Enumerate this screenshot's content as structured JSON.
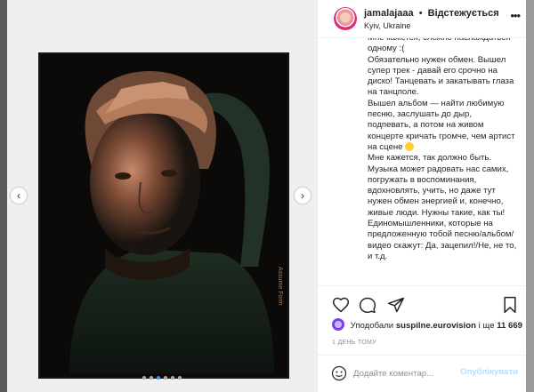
{
  "colors": {
    "accent": "#3897f0",
    "text": "#262626",
    "muted": "#8e8e8e",
    "publish_disabled": "#b2dffc"
  },
  "post": {
    "username": "jamalajaaa",
    "separator": "•",
    "follow_state": "Відстежується",
    "location": "Kyiv, Ukraine",
    "more_icon": "more-horizontal-icon",
    "photo": {
      "credit": "Assume Form"
    },
    "carousel": {
      "prev_icon": "chevron-left-icon",
      "next_icon": "chevron-right-icon",
      "dot_count": 6,
      "active_index": 2
    },
    "caption": [
      "Мне кажется, сложно наслаждаться одному :(",
      "Обязательно нужен обмен. Вышел супер трек - давай его срочно на диско! Танцевать и закатывать глаза на танцполе.",
      "Вышел альбом — найти любимую песню, заслушать до дыр, подпевать, а потом на живом концерте кричать громче, чем артист на сцене",
      "Мне кажется, так должно быть. Музыка может радовать нас самих, погружать в воспоминания, вдохновлять, учить, но даже тут нужен обмен энергией и, конечно, живые люди. Нужны такие, как ты! Единомышленники, которые на предложенную тобой песню/альбом/видео скажут: Да, зацепил!/Не, не то, и т.д."
    ],
    "likes": {
      "prefix": "Уподобали",
      "user": "suspilne.eurovision",
      "middle": "і ще",
      "count": "11 669"
    },
    "timestamp": "1 ДЕНЬ ТОМУ",
    "comment": {
      "placeholder": "Додайте коментар...",
      "value": "",
      "publish_label": "Опублікувати"
    }
  }
}
